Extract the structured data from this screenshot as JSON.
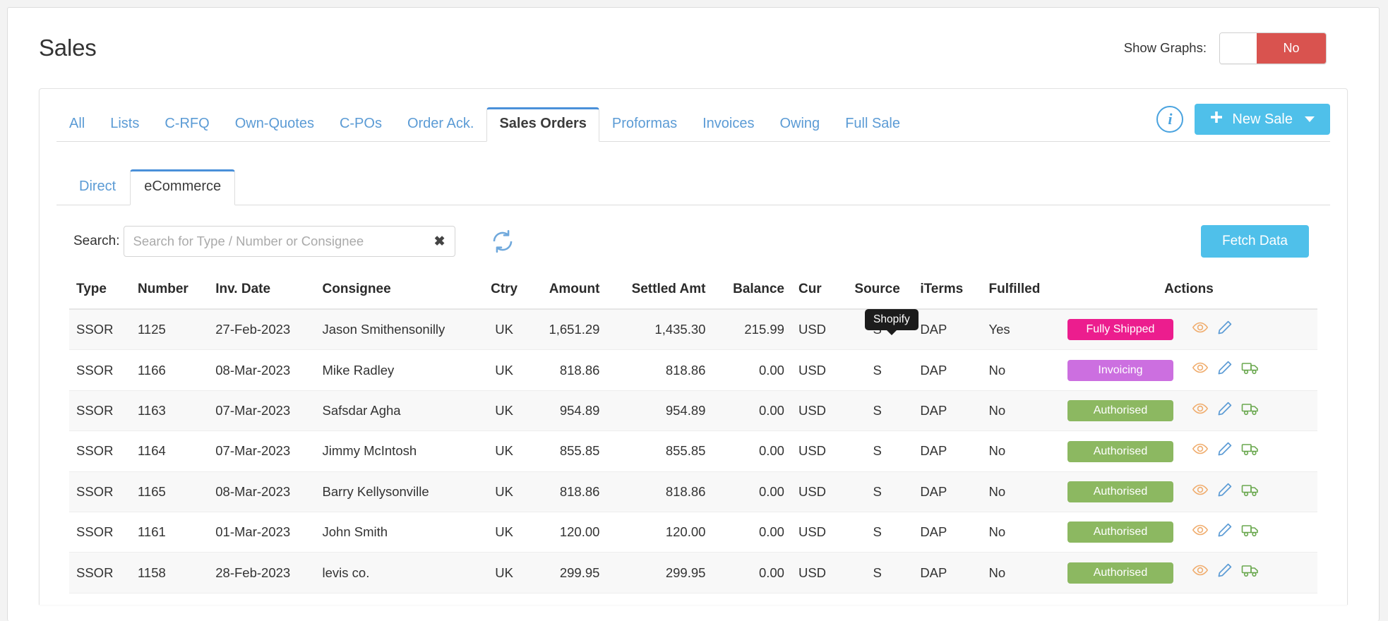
{
  "header": {
    "title": "Sales",
    "show_graphs_label": "Show Graphs:",
    "toggle_value": "No"
  },
  "main_tabs": [
    {
      "label": "All",
      "active": false
    },
    {
      "label": "Lists",
      "active": false
    },
    {
      "label": "C-RFQ",
      "active": false
    },
    {
      "label": "Own-Quotes",
      "active": false
    },
    {
      "label": "C-POs",
      "active": false
    },
    {
      "label": "Order Ack.",
      "active": false
    },
    {
      "label": "Sales Orders",
      "active": true
    },
    {
      "label": "Proformas",
      "active": false
    },
    {
      "label": "Invoices",
      "active": false
    },
    {
      "label": "Owing",
      "active": false
    },
    {
      "label": "Full Sale",
      "active": false
    }
  ],
  "tab_actions": {
    "info_icon": "info-circle-icon",
    "new_sale_label": "New Sale",
    "plus_icon": "plus-icon",
    "caret_icon": "chevron-down-icon"
  },
  "sub_tabs": [
    {
      "label": "Direct",
      "active": false
    },
    {
      "label": "eCommerce",
      "active": true
    }
  ],
  "search": {
    "label": "Search:",
    "placeholder": "Search for Type / Number or Consignee",
    "value": "",
    "clear_icon": "close-icon",
    "refresh_icon": "refresh-icon",
    "fetch_label": "Fetch Data"
  },
  "tooltip": {
    "text": "Shopify"
  },
  "table": {
    "columns": [
      "Type",
      "Number",
      "Inv. Date",
      "Consignee",
      "Ctry",
      "Amount",
      "Settled Amt",
      "Balance",
      "Cur",
      "Source",
      "iTerms",
      "Fulfilled",
      "Actions"
    ],
    "rows": [
      {
        "type": "SSOR",
        "number": "1125",
        "date": "27-Feb-2023",
        "consignee": "Jason Smithensonilly",
        "ctry": "UK",
        "amount": "1,651.29",
        "settled": "1,435.30",
        "balance": "215.99",
        "cur": "USD",
        "source": "S",
        "iterms": "DAP",
        "fulfilled": "Yes",
        "badge": "Fully Shipped",
        "badge_color": "#ec1d8e",
        "has_truck": false
      },
      {
        "type": "SSOR",
        "number": "1166",
        "date": "08-Mar-2023",
        "consignee": "Mike Radley",
        "ctry": "UK",
        "amount": "818.86",
        "settled": "818.86",
        "balance": "0.00",
        "cur": "USD",
        "source": "S",
        "iterms": "DAP",
        "fulfilled": "No",
        "badge": "Invoicing",
        "badge_color": "#cc6fe0",
        "has_truck": true
      },
      {
        "type": "SSOR",
        "number": "1163",
        "date": "07-Mar-2023",
        "consignee": "Safsdar Agha",
        "ctry": "UK",
        "amount": "954.89",
        "settled": "954.89",
        "balance": "0.00",
        "cur": "USD",
        "source": "S",
        "iterms": "DAP",
        "fulfilled": "No",
        "badge": "Authorised",
        "badge_color": "#8cb861",
        "has_truck": true
      },
      {
        "type": "SSOR",
        "number": "1164",
        "date": "07-Mar-2023",
        "consignee": "Jimmy McIntosh",
        "ctry": "UK",
        "amount": "855.85",
        "settled": "855.85",
        "balance": "0.00",
        "cur": "USD",
        "source": "S",
        "iterms": "DAP",
        "fulfilled": "No",
        "badge": "Authorised",
        "badge_color": "#8cb861",
        "has_truck": true
      },
      {
        "type": "SSOR",
        "number": "1165",
        "date": "08-Mar-2023",
        "consignee": "Barry Kellysonville",
        "ctry": "UK",
        "amount": "818.86",
        "settled": "818.86",
        "balance": "0.00",
        "cur": "USD",
        "source": "S",
        "iterms": "DAP",
        "fulfilled": "No",
        "badge": "Authorised",
        "badge_color": "#8cb861",
        "has_truck": true
      },
      {
        "type": "SSOR",
        "number": "1161",
        "date": "01-Mar-2023",
        "consignee": "John Smith",
        "ctry": "UK",
        "amount": "120.00",
        "settled": "120.00",
        "balance": "0.00",
        "cur": "USD",
        "source": "S",
        "iterms": "DAP",
        "fulfilled": "No",
        "badge": "Authorised",
        "badge_color": "#8cb861",
        "has_truck": true
      },
      {
        "type": "SSOR",
        "number": "1158",
        "date": "28-Feb-2023",
        "consignee": "levis co.",
        "ctry": "UK",
        "amount": "299.95",
        "settled": "299.95",
        "balance": "0.00",
        "cur": "USD",
        "source": "S",
        "iterms": "DAP",
        "fulfilled": "No",
        "badge": "Authorised",
        "badge_color": "#8cb861",
        "has_truck": true
      }
    ],
    "action_icons": {
      "view": "eye-icon",
      "edit": "pencil-icon",
      "ship": "delivery-truck-icon"
    }
  }
}
